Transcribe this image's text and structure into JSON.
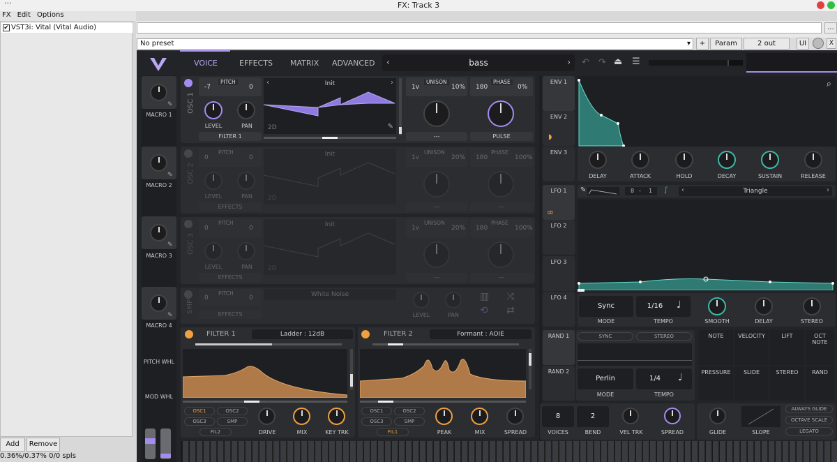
{
  "window": {
    "title": "FX: Track 3",
    "dots": "···"
  },
  "menu": [
    "FX",
    "Edit",
    "Options"
  ],
  "fx_chain": {
    "item": "VST3i: Vital (Vital Audio)",
    "add": "Add",
    "remove": "Remove",
    "status": "0.36%/0.37% 0/0 spls"
  },
  "host": {
    "preset": "No preset",
    "plus": "+",
    "param": "Param",
    "out": "2 out",
    "ui": "UI",
    "more": "...",
    "close": "X"
  },
  "tabs": [
    "VOICE",
    "EFFECTS",
    "MATRIX",
    "ADVANCED"
  ],
  "preset_name": "bass",
  "macros": [
    "MACRO 1",
    "MACRO 2",
    "MACRO 3",
    "MACRO 4"
  ],
  "wheels": [
    "PITCH WHL",
    "MOD WHL"
  ],
  "osc": [
    {
      "name": "OSC 1",
      "pitch_l": "-7",
      "pitch_r": "0",
      "pitch": "PITCH",
      "wave": "Init",
      "dest": "FILTER 1",
      "unison_v": "1v",
      "unison_p": "10%",
      "unison": "UNISON",
      "phase_v": "180",
      "phase_p": "0%",
      "phase": "PHASE",
      "mode": "PULSE",
      "tag": "2D"
    },
    {
      "name": "OSC 2",
      "pitch_l": "0",
      "pitch_r": "0",
      "pitch": "PITCH",
      "wave": "Init",
      "dest": "EFFECTS",
      "unison_v": "1v",
      "unison_p": "20%",
      "unison": "UNISON",
      "phase_v": "180",
      "phase_p": "100%",
      "phase": "PHASE",
      "mode": "---",
      "tag": "2D"
    },
    {
      "name": "OSC 3",
      "pitch_l": "0",
      "pitch_r": "0",
      "pitch": "PITCH",
      "wave": "Init",
      "dest": "EFFECTS",
      "unison_v": "1v",
      "unison_p": "20%",
      "unison": "UNISON",
      "phase_v": "180",
      "phase_p": "100%",
      "phase": "PHASE",
      "mode": "---",
      "tag": "2D"
    }
  ],
  "osc_labels": {
    "level": "LEVEL",
    "pan": "PAN",
    "dash": "---"
  },
  "smp": {
    "name": "SMP",
    "l": "0",
    "r": "0",
    "pitch": "PITCH",
    "wave": "White Noise",
    "dest": "EFFECTS",
    "level": "LEVEL",
    "pan": "PAN"
  },
  "filter1": {
    "name": "FILTER 1",
    "type": "Ladder : 12dB",
    "routes": [
      "OSC1",
      "OSC2",
      "OSC3",
      "SMP"
    ],
    "next": "FIL2",
    "knobs": [
      "DRIVE",
      "MIX",
      "KEY TRK"
    ]
  },
  "filter2": {
    "name": "FILTER 2",
    "type": "Formant : AOIE",
    "routes": [
      "OSC1",
      "OSC2",
      "OSC3",
      "SMP"
    ],
    "next": "FIL1",
    "knobs": [
      "PEAK",
      "MIX",
      "SPREAD"
    ]
  },
  "envs": [
    "ENV 1",
    "ENV 2",
    "ENV 3"
  ],
  "env_knobs": [
    "DELAY",
    "ATTACK",
    "HOLD",
    "DECAY",
    "SUSTAIN",
    "RELEASE"
  ],
  "lfos": [
    "LFO 1",
    "LFO 2",
    "LFO 3",
    "LFO 4"
  ],
  "lfo": {
    "frac_a": "8",
    "frac_b": "1",
    "shape": "Triangle",
    "mode": "Sync",
    "mode_lbl": "MODE",
    "tempo": "1/16",
    "tempo_lbl": "TEMPO",
    "knobs": [
      "SMOOTH",
      "DELAY",
      "STEREO"
    ]
  },
  "rands": [
    "RAND 1",
    "RAND 2"
  ],
  "rand": {
    "sync": "SYNC",
    "stereo": "STEREO",
    "mode": "Perlin",
    "mode_lbl": "MODE",
    "tempo": "1/4",
    "tempo_lbl": "TEMPO"
  },
  "mod_grid": [
    "NOTE",
    "VELOCITY",
    "LIFT",
    "OCT NOTE",
    "PRESSURE",
    "SLIDE",
    "STEREO",
    "RAND"
  ],
  "voice": {
    "voices": "8",
    "voices_lbl": "VOICES",
    "bend": "2",
    "bend_lbl": "BEND",
    "veltrk": "VEL TRK",
    "spread": "SPREAD"
  },
  "glide": {
    "glide": "GLIDE",
    "slope": "SLOPE",
    "opts": [
      "ALWAYS GLIDE",
      "OCTAVE SCALE",
      "LEGATO"
    ]
  },
  "colors": {
    "accent": "#a58cf0",
    "env": "#3fb8a8",
    "filter": "#c99058",
    "orange": "#f0a040"
  }
}
